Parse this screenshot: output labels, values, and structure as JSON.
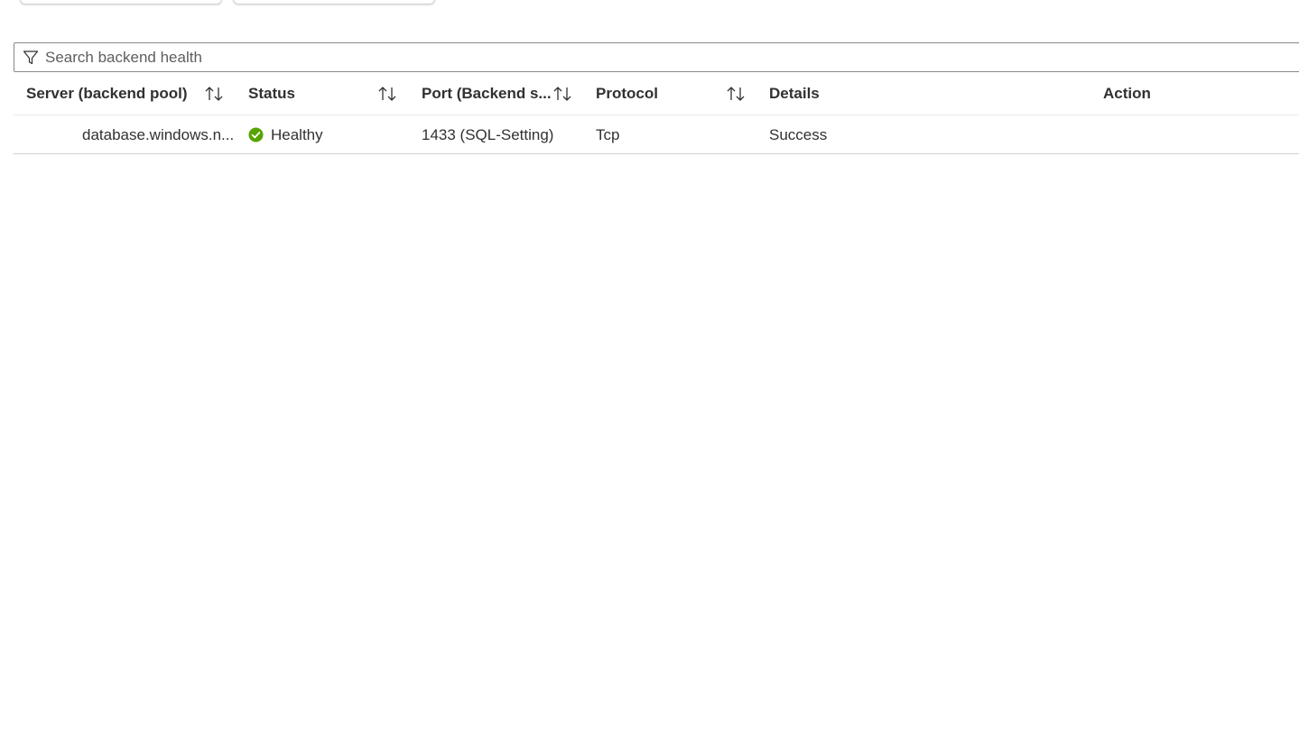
{
  "search": {
    "placeholder": "Search backend health",
    "value": ""
  },
  "table": {
    "columns": [
      {
        "key": "server",
        "label": "Server (backend pool)",
        "sortable": true
      },
      {
        "key": "status",
        "label": "Status",
        "sortable": true
      },
      {
        "key": "port",
        "label": "Port (Backend s...",
        "sortable": true
      },
      {
        "key": "protocol",
        "label": "Protocol",
        "sortable": true
      },
      {
        "key": "details",
        "label": "Details",
        "sortable": false
      },
      {
        "key": "action",
        "label": "Action",
        "sortable": false
      }
    ],
    "rows": [
      {
        "server": "database.windows.n...",
        "status": "Healthy",
        "port": "1433 (SQL-Setting)",
        "protocol": "Tcp",
        "details": "Success",
        "action": ""
      }
    ]
  },
  "icons": {
    "filter": "filter-icon",
    "sort": "sort-arrows-icon",
    "status_healthy": "check-circle-icon"
  },
  "colors": {
    "healthy": "#57a300",
    "text": "#323130",
    "border": "#8a8886"
  }
}
